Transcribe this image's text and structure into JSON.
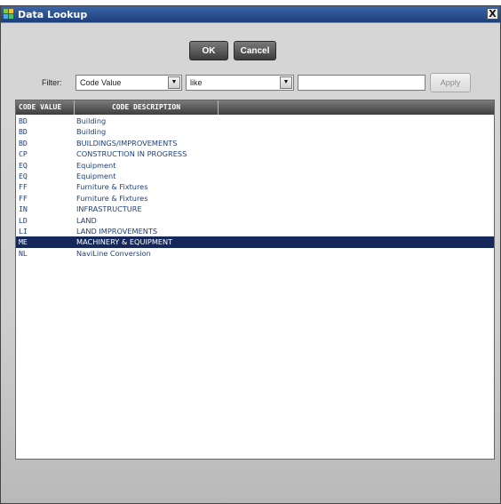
{
  "window": {
    "title": "Data Lookup",
    "close_label": "X"
  },
  "toolbar": {
    "ok_label": "OK",
    "cancel_label": "Cancel"
  },
  "filter": {
    "label": "Filter:",
    "field_value": "Code Value",
    "operator_value": "like",
    "input_value": "",
    "apply_label": "Apply"
  },
  "table": {
    "columns": [
      "CODE VALUE",
      "CODE DESCRIPTION",
      ""
    ],
    "rows": [
      {
        "code": "BD",
        "description": "Building"
      },
      {
        "code": "BD",
        "description": "Building"
      },
      {
        "code": "BD",
        "description": "BUILDINGS/IMPROVEMENTS"
      },
      {
        "code": "CP",
        "description": "CONSTRUCTION IN PROGRESS"
      },
      {
        "code": "EQ",
        "description": "Equipment"
      },
      {
        "code": "EQ",
        "description": "Equipment"
      },
      {
        "code": "FF",
        "description": "Furniture & Fixtures"
      },
      {
        "code": "FF",
        "description": "Furniture & Fixtures"
      },
      {
        "code": "IN",
        "description": "INFRASTRUCTURE"
      },
      {
        "code": "LD",
        "description": "LAND"
      },
      {
        "code": "LI",
        "description": "LAND IMPROVEMENTS"
      },
      {
        "code": "ME",
        "description": "MACHINERY & EQUIPMENT"
      },
      {
        "code": "NL",
        "description": "NaviLine Conversion"
      }
    ],
    "selected_index": 11
  },
  "colors": {
    "selected_row_bg": "#15285a",
    "row_text": "#1f3f7a",
    "titlebar": "#1d3f7a"
  },
  "icons": {
    "title_icon": "app-windows-icon",
    "dropdown": "dropdown-arrow-icon"
  }
}
